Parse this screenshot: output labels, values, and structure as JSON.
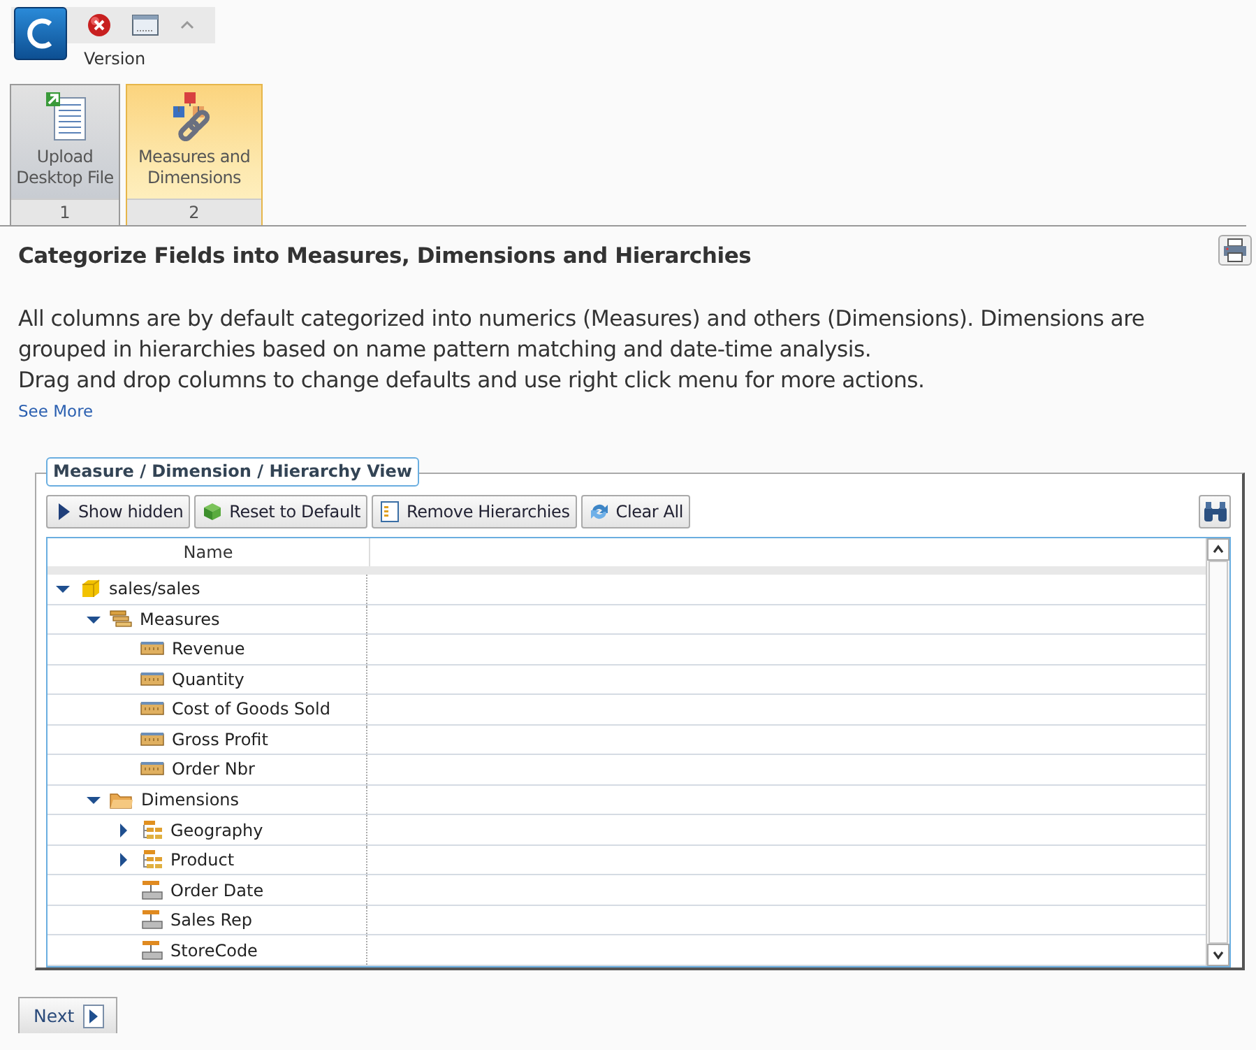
{
  "app_bar": {
    "label": "Version"
  },
  "steps": [
    {
      "label": "Upload Desktop File",
      "number": "1",
      "kind": "upload",
      "selected": false
    },
    {
      "label": "Measures and Dimensions",
      "number": "2",
      "kind": "link",
      "selected": true
    }
  ],
  "heading": "Categorize Fields into Measures, Dimensions and Hierarchies",
  "description": [
    "All columns are by default categorized into numerics (Measures) and others (Dimensions). Dimensions are grouped in hierarchies based on name pattern matching and date-time analysis.",
    "Drag and drop columns to change defaults and use right click menu for more actions."
  ],
  "see_more": "See More",
  "panel": {
    "title": "Measure / Dimension / Hierarchy View",
    "buttons": [
      {
        "label": "Show hidden",
        "kind": "play"
      },
      {
        "label": "Reset to Default",
        "kind": "stack"
      },
      {
        "label": "Remove Hierarchies",
        "kind": "list"
      },
      {
        "label": "Clear All",
        "kind": "refresh"
      }
    ],
    "columns": [
      "Name"
    ],
    "tree": [
      {
        "label": "sales/sales",
        "kind": "cube",
        "expanded": true,
        "children": [
          {
            "label": "Measures",
            "kind": "measures",
            "expanded": true,
            "children": [
              {
                "label": "Revenue",
                "kind": "measure"
              },
              {
                "label": "Quantity",
                "kind": "measure"
              },
              {
                "label": "Cost of Goods Sold",
                "kind": "measure"
              },
              {
                "label": "Gross Profit",
                "kind": "measure"
              },
              {
                "label": "Order Nbr",
                "kind": "measure"
              }
            ]
          },
          {
            "label": "Dimensions",
            "kind": "folder",
            "expanded": true,
            "children": [
              {
                "label": "Geography",
                "kind": "hierarchy",
                "expanded": false
              },
              {
                "label": "Product",
                "kind": "hierarchy",
                "expanded": false
              },
              {
                "label": "Order Date",
                "kind": "level"
              },
              {
                "label": "Sales Rep",
                "kind": "level"
              },
              {
                "label": "StoreCode",
                "kind": "level"
              }
            ]
          }
        ]
      }
    ]
  },
  "next_button": "Next"
}
